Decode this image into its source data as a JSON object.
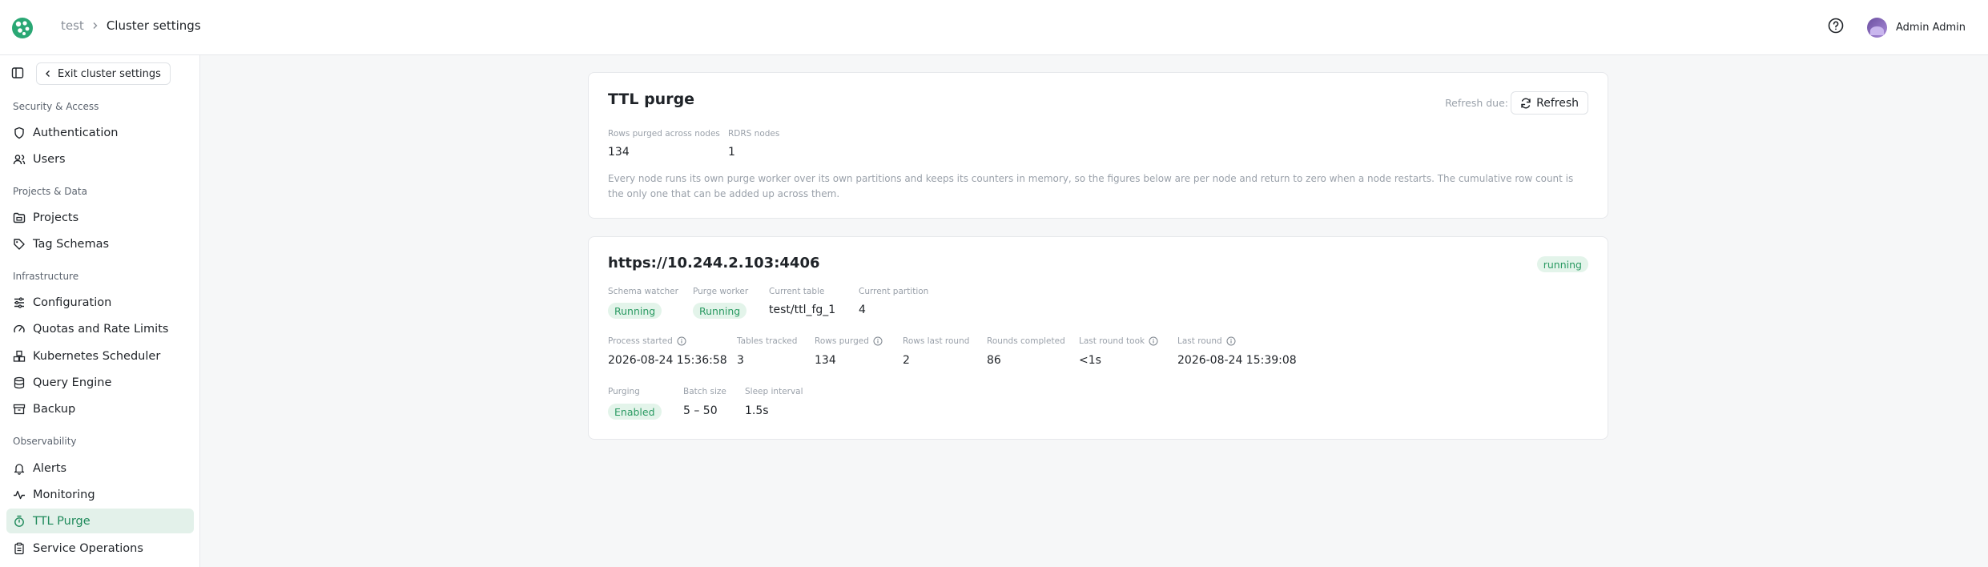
{
  "header": {
    "breadcrumb": [
      "test",
      "Cluster settings"
    ],
    "user_name": "Admin Admin"
  },
  "sidebar": {
    "exit_label": "Exit cluster settings",
    "sections": [
      "Security & Access",
      "Projects & Data",
      "Infrastructure",
      "Observability"
    ],
    "items": [
      {
        "label": "Authentication",
        "icon": "shield-icon"
      },
      {
        "label": "Users",
        "icon": "users-icon"
      },
      {
        "label": "Projects",
        "icon": "folder-icon"
      },
      {
        "label": "Tag Schemas",
        "icon": "tag-icon"
      },
      {
        "label": "Configuration",
        "icon": "sliders-icon"
      },
      {
        "label": "Quotas and Rate Limits",
        "icon": "gauge-icon"
      },
      {
        "label": "Kubernetes Scheduler",
        "icon": "boxes-icon"
      },
      {
        "label": "Query Engine",
        "icon": "database-icon"
      },
      {
        "label": "Backup",
        "icon": "archive-icon"
      },
      {
        "label": "Alerts",
        "icon": "bell-icon"
      },
      {
        "label": "Monitoring",
        "icon": "activity-icon"
      },
      {
        "label": "TTL Purge",
        "icon": "timer-icon",
        "active": true
      },
      {
        "label": "Service Operations",
        "icon": "clipboard-icon"
      }
    ]
  },
  "summary": {
    "title": "TTL purge",
    "refresh_due": "Refresh due:",
    "refresh_label": "Refresh",
    "stats": [
      {
        "label": "Rows purged across nodes",
        "value": "134"
      },
      {
        "label": "RDRS nodes",
        "value": "1"
      }
    ],
    "description": "Every node runs its own purge worker over its own partitions and keeps its counters in memory, so the figures below are per node and return to zero when a node restarts. The cumulative row count is the only one that can be added up across them."
  },
  "node": {
    "address": "https://10.244.2.103:4406",
    "status": "running",
    "row1": [
      {
        "label": "Schema watcher",
        "value": "Running",
        "badge": true
      },
      {
        "label": "Purge worker",
        "value": "Running",
        "badge": true
      },
      {
        "label": "Current table",
        "value": "test/ttl_fg_1"
      },
      {
        "label": "Current partition",
        "value": "4"
      }
    ],
    "row2": [
      {
        "label": "Process started",
        "value": "2026-08-24 15:36:58",
        "info": true
      },
      {
        "label": "Tables tracked",
        "value": "3"
      },
      {
        "label": "Rows purged",
        "value": "134",
        "info": true
      },
      {
        "label": "Rows last round",
        "value": "2"
      },
      {
        "label": "Rounds completed",
        "value": "86"
      },
      {
        "label": "Last round took",
        "value": "<1s",
        "info": true
      },
      {
        "label": "Last round",
        "value": "2026-08-24 15:39:08",
        "info": true
      }
    ],
    "row3": [
      {
        "label": "Purging",
        "value": "Enabled",
        "badge": true
      },
      {
        "label": "Batch size",
        "value": "5 – 50"
      },
      {
        "label": "Sleep interval",
        "value": "1.5s"
      }
    ]
  },
  "colors": {
    "accent": "#1f8a5b",
    "active_bg": "#e3f1ea",
    "badge_bg": "#e3f4ea",
    "badge_text": "#2a9a62"
  }
}
